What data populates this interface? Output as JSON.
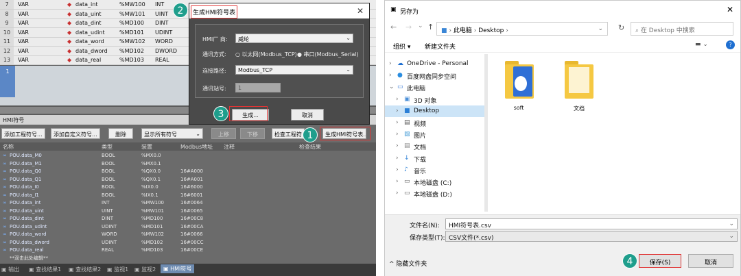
{
  "var_rows": [
    {
      "num": "7",
      "kind": "VAR",
      "name": "data_int",
      "addr": "%MW100",
      "type": "INT"
    },
    {
      "num": "8",
      "kind": "VAR",
      "name": "data_uint",
      "addr": "%MW101",
      "type": "UINT"
    },
    {
      "num": "9",
      "kind": "VAR",
      "name": "data_dint",
      "addr": "%MD100",
      "type": "DINT"
    },
    {
      "num": "10",
      "kind": "VAR",
      "name": "data_udint",
      "addr": "%MD101",
      "type": "UDINT"
    },
    {
      "num": "11",
      "kind": "VAR",
      "name": "data_word",
      "addr": "%MW102",
      "type": "WORD"
    },
    {
      "num": "12",
      "kind": "VAR",
      "name": "data_dword",
      "addr": "%MD102",
      "type": "DWORD"
    },
    {
      "num": "13",
      "kind": "VAR",
      "name": "data_real",
      "addr": "%MD103",
      "type": "REAL"
    }
  ],
  "editor_line": "1",
  "panel": {
    "title": "HMI符号",
    "btn_add_project": "添加工程符号...",
    "btn_add_custom": "添加自定义符号...",
    "btn_delete": "删除",
    "filter": "显示所有符号",
    "btn_up": "上移",
    "btn_down": "下移",
    "btn_check": "检查工程符",
    "btn_generate": "生成HMI符号表...",
    "headers": {
      "name": "名称",
      "type": "类型",
      "dev": "装置",
      "modbus": "Modbus地址",
      "comment": "注释",
      "check": "检查结果"
    },
    "rows": [
      {
        "name": "POU.data_M0",
        "type": "BOOL",
        "dev": "%MX0.0",
        "modbus": ""
      },
      {
        "name": "POU.data_M1",
        "type": "BOOL",
        "dev": "%MX0.1",
        "modbus": ""
      },
      {
        "name": "POU.data_Q0",
        "type": "BOOL",
        "dev": "%QX0.0",
        "modbus": "16#A000"
      },
      {
        "name": "POU.data_Q1",
        "type": "BOOL",
        "dev": "%QX0.1",
        "modbus": "16#A001"
      },
      {
        "name": "POU.data_I0",
        "type": "BOOL",
        "dev": "%IX0.0",
        "modbus": "16#6000"
      },
      {
        "name": "POU.data_I1",
        "type": "BOOL",
        "dev": "%IX0.1",
        "modbus": "16#6001"
      },
      {
        "name": "POU.data_int",
        "type": "INT",
        "dev": "%MW100",
        "modbus": "16#0064"
      },
      {
        "name": "POU.data_uint",
        "type": "UINT",
        "dev": "%MW101",
        "modbus": "16#0065"
      },
      {
        "name": "POU.data_dint",
        "type": "DINT",
        "dev": "%MD100",
        "modbus": "16#00C8"
      },
      {
        "name": "POU.data_udint",
        "type": "UDINT",
        "dev": "%MD101",
        "modbus": "16#00CA"
      },
      {
        "name": "POU.data_word",
        "type": "WORD",
        "dev": "%MW102",
        "modbus": "16#0066"
      },
      {
        "name": "POU.data_dword",
        "type": "UDINT",
        "dev": "%MD102",
        "modbus": "16#00CC"
      },
      {
        "name": "POU.data_real",
        "type": "REAL",
        "dev": "%MD103",
        "modbus": "16#00CE"
      }
    ],
    "dblclick_hint": "**双击此处编辑**",
    "tabs": [
      "输出",
      "查找结果1",
      "查找结果2",
      "监视1",
      "监视2",
      "HMI符号"
    ]
  },
  "dialog": {
    "title": "生成HMI符号表",
    "close": "✕",
    "vendor_label": "HMI厂 商:",
    "vendor_value": "威纶",
    "comm_label": "通讯方式:",
    "comm_opt1": "以太网(Modbus_TCP)",
    "comm_opt2": "串口(Modbus_Serial)",
    "path_label": "连接路径:",
    "path_value": "Modbus_TCP",
    "station_label": "通讯站号:",
    "station_value": "1",
    "generate": "生成...",
    "cancel": "取消"
  },
  "badges": [
    "1",
    "2",
    "3",
    "4"
  ],
  "save": {
    "title": "另存为",
    "breadcrumb": [
      "此电脑",
      "Desktop"
    ],
    "search_placeholder": "在 Desktop 中搜索",
    "organize": "组织 ▾",
    "new_folder": "新建文件夹",
    "tree": [
      "OneDrive - Personal",
      "百度网盘同步空间",
      "此电脑",
      "3D 对象",
      "Desktop",
      "视频",
      "图片",
      "文档",
      "下载",
      "音乐",
      "本地磁盘 (C:)",
      "本地磁盘 (D:)"
    ],
    "files": [
      "soft",
      "文档"
    ],
    "filename_label": "文件名(N):",
    "filename_value": "HMI符号表.csv",
    "filetype_label": "保存类型(T):",
    "filetype_value": "CSV文件(*.csv)",
    "hide_folders": "隐藏文件夹",
    "save_btn": "保存(S)",
    "cancel_btn": "取消"
  }
}
